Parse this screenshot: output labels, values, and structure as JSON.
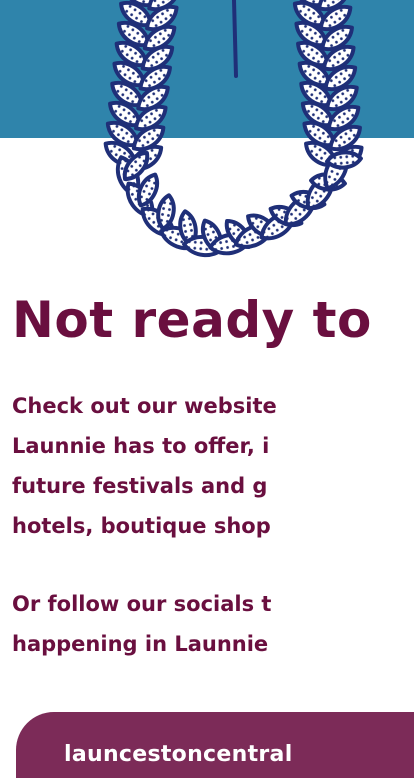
{
  "colors": {
    "hero_band": "#2f84ab",
    "headline_text": "#6a0f3f",
    "cta_background": "#7c2b58",
    "cta_text": "#ffffff",
    "lei_outline": "#1f2f78"
  },
  "hero": {
    "illustration_icon": "lei-garland-icon"
  },
  "headline": "Not ready to",
  "paragraph_1": {
    "lines": [
      "Check out our website",
      "Launnie has to offer, i",
      "future festivals and g",
      "hotels, boutique shop"
    ]
  },
  "paragraph_2": {
    "lines": [
      "Or follow our socials t",
      "happening in Launnie"
    ]
  },
  "cta": {
    "label": "launcestoncentral"
  }
}
